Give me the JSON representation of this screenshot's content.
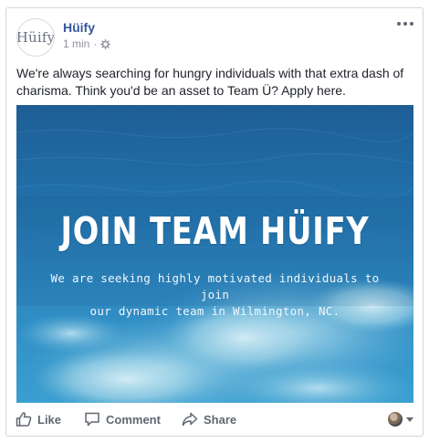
{
  "post": {
    "author": "Hüify",
    "avatar_text": "Hüify",
    "timestamp": "1 min",
    "separator": "·",
    "audience_icon": "gear-icon",
    "more_icon": "ellipsis-icon",
    "text": "We're always searching for hungry individuals with that extra dash of charisma. Think you'd be an asset to Team Ü? Apply here."
  },
  "image": {
    "headline": "JOIN TEAM HÜIFY",
    "subline_1": "We are seeking highly motivated individuals to join",
    "subline_2": "our dynamic team in Wilmington, NC."
  },
  "actions": {
    "like_label": "Like",
    "comment_label": "Comment",
    "share_label": "Share",
    "like_icon": "thumbs-up-icon",
    "comment_icon": "speech-bubble-icon",
    "share_icon": "share-arrow-icon"
  },
  "colors": {
    "author_link": "#365899",
    "meta_text": "#90949c",
    "body_text": "#1d2129",
    "action_text": "#606770",
    "ocean_dark": "#1b5f93",
    "ocean_mid": "#2a83bd",
    "wave_light": "#9fd3e6"
  }
}
